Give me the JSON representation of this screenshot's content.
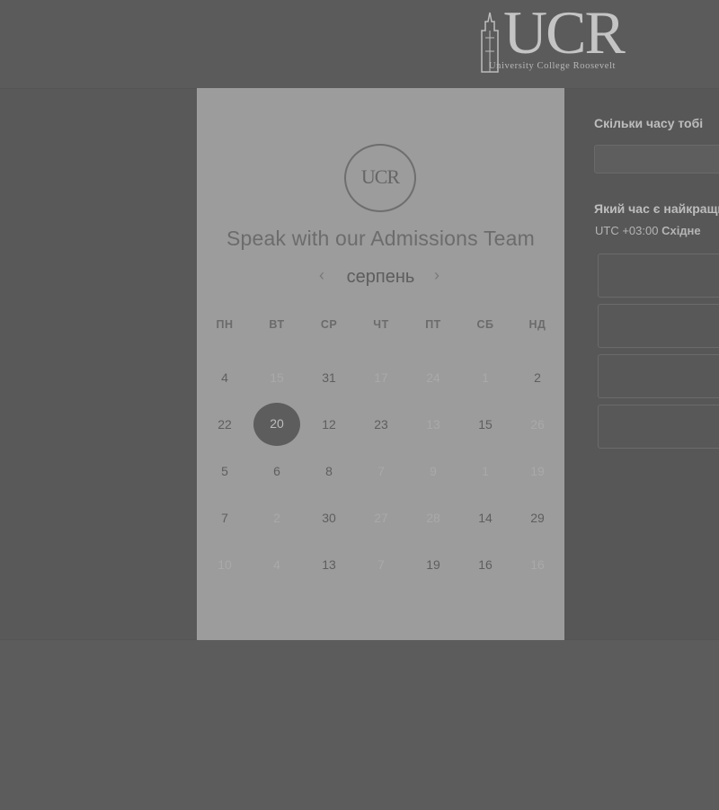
{
  "header": {
    "logo_text": "UCR",
    "logo_subtitle": "University College Roosevelt"
  },
  "card": {
    "avatar_text": "UCR",
    "title": "Speak with our Admissions Team",
    "month": "серпень",
    "prev_icon": "chevron-left-icon",
    "next_icon": "chevron-right-icon",
    "weekdays": [
      "ПН",
      "ВТ",
      "СР",
      "ЧТ",
      "ПТ",
      "СБ",
      "НД"
    ],
    "weeks": [
      [
        "4",
        "15",
        "31",
        "17",
        "24",
        "1",
        "2"
      ],
      [
        "22",
        "20",
        "12",
        "23",
        "13",
        "15",
        "26"
      ],
      [
        "5",
        "6",
        "8",
        "7",
        "9",
        "1",
        "19"
      ],
      [
        "7",
        "2",
        "30",
        "27",
        "28",
        "14",
        "29"
      ],
      [
        "10",
        "4",
        "13",
        "7",
        "19",
        "16",
        "16"
      ]
    ],
    "muted_flags": [
      [
        0,
        1,
        0,
        1,
        1,
        1,
        0
      ],
      [
        0,
        0,
        0,
        0,
        1,
        0,
        1
      ],
      [
        0,
        0,
        0,
        1,
        1,
        1,
        1
      ],
      [
        0,
        1,
        0,
        1,
        1,
        0,
        0
      ],
      [
        1,
        1,
        0,
        1,
        0,
        0,
        1
      ]
    ],
    "selected_day": "20"
  },
  "side": {
    "duration_question": "Скільки часу тобі",
    "time_question": "Який час є найкращий",
    "timezone_offset": "UTC +03:00",
    "timezone_name": "Східне"
  }
}
